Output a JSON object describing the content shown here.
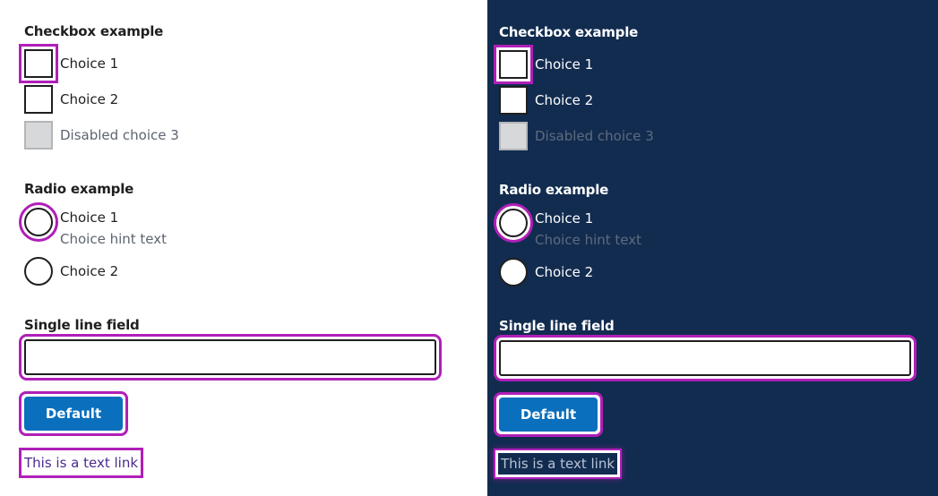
{
  "colors": {
    "focus_ring": "#b01fb8",
    "dark_background": "#122c50",
    "button_primary": "#0a6fbd",
    "link_light": "#4a2a8f",
    "link_dark": "#b6c3d6",
    "disabled_fill": "#d7d8da"
  },
  "panels": [
    {
      "theme": "light",
      "checkbox": {
        "title": "Checkbox example",
        "choices": [
          {
            "label": "Choice 1",
            "focused": true,
            "disabled": false
          },
          {
            "label": "Choice 2",
            "focused": false,
            "disabled": false
          },
          {
            "label": "Disabled choice 3",
            "focused": false,
            "disabled": true
          }
        ]
      },
      "radio": {
        "title": "Radio example",
        "choices": [
          {
            "label": "Choice 1",
            "hint": "Choice hint text",
            "focused": true
          },
          {
            "label": "Choice 2",
            "focused": false
          }
        ]
      },
      "field": {
        "label": "Single line field",
        "value": "",
        "placeholder": ""
      },
      "button": {
        "label": "Default"
      },
      "link": {
        "label": "This is a text link"
      }
    },
    {
      "theme": "dark",
      "checkbox": {
        "title": "Checkbox example",
        "choices": [
          {
            "label": "Choice 1",
            "focused": true,
            "disabled": false
          },
          {
            "label": "Choice 2",
            "focused": false,
            "disabled": false
          },
          {
            "label": "Disabled choice 3",
            "focused": false,
            "disabled": true
          }
        ]
      },
      "radio": {
        "title": "Radio example",
        "choices": [
          {
            "label": "Choice 1",
            "hint": "Choice hint text",
            "focused": true
          },
          {
            "label": "Choice 2",
            "focused": false
          }
        ]
      },
      "field": {
        "label": "Single line field",
        "value": "",
        "placeholder": ""
      },
      "button": {
        "label": "Default"
      },
      "link": {
        "label": "This is a text link"
      }
    }
  ]
}
